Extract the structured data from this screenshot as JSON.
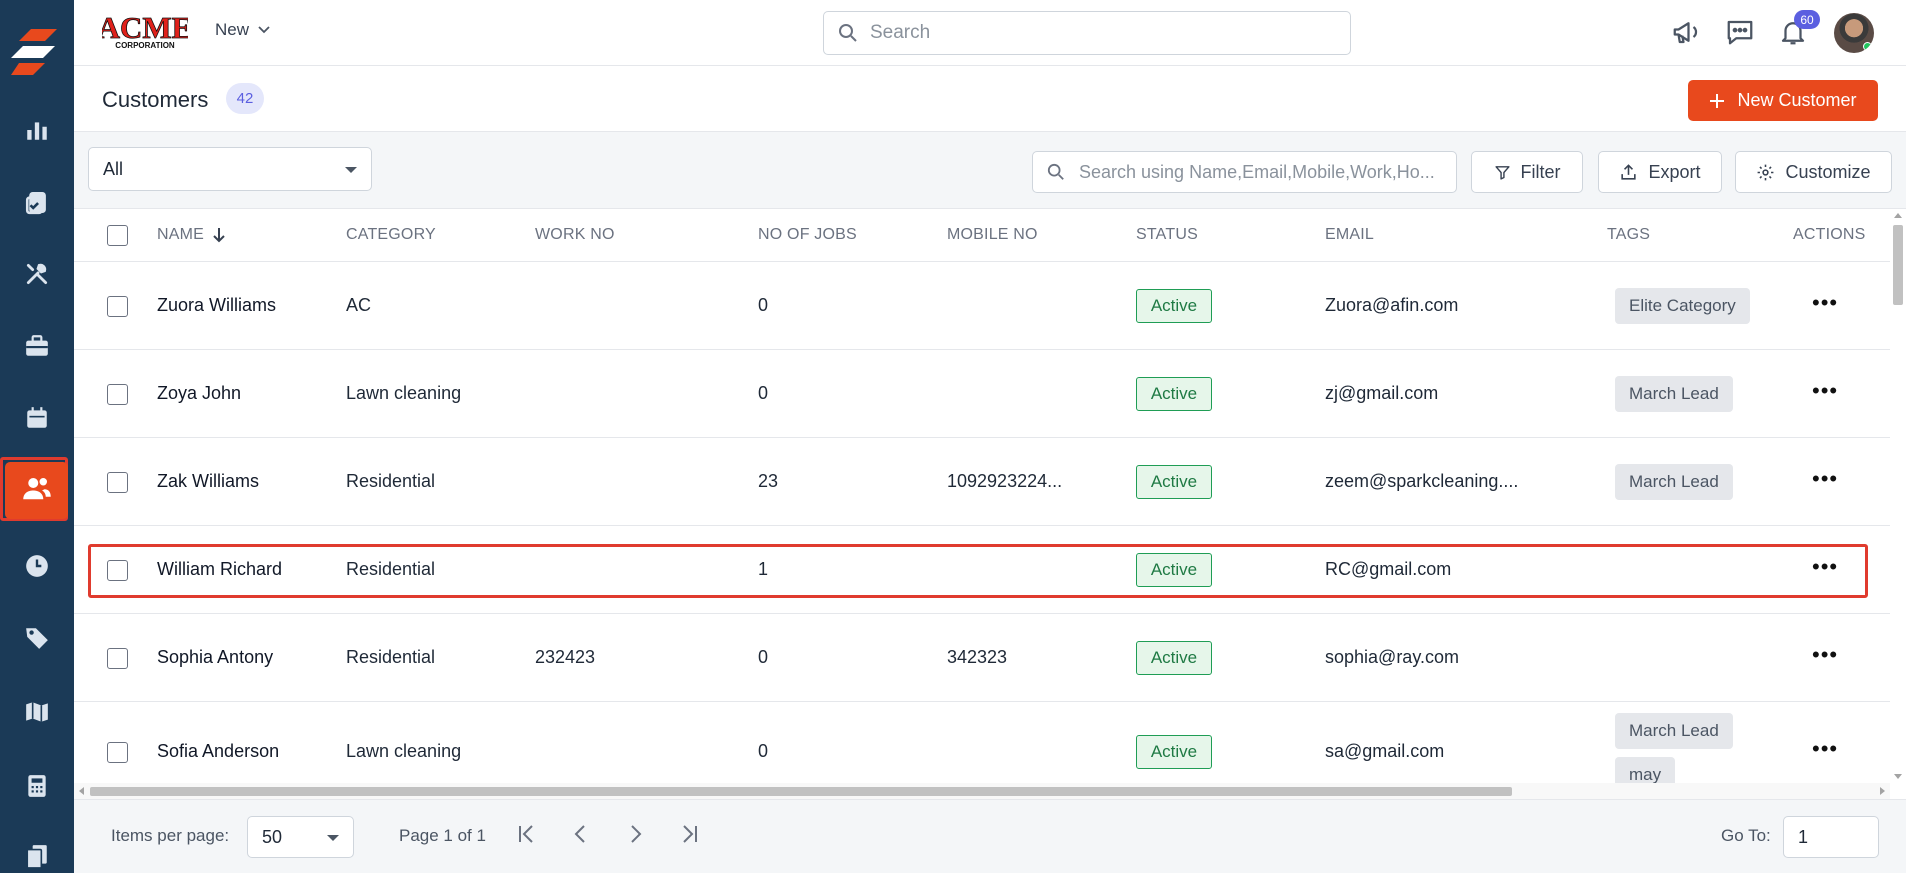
{
  "brand": {
    "logo_main": "ACME",
    "logo_sub": "CORPORATION"
  },
  "header": {
    "new_menu_label": "New",
    "search_placeholder": "Search",
    "notification_count": "60"
  },
  "sidebar": {
    "items": [
      {
        "name": "reports",
        "icon": "bar-chart-icon"
      },
      {
        "name": "jobs",
        "icon": "clipboard-check-icon"
      },
      {
        "name": "tools",
        "icon": "tools-icon"
      },
      {
        "name": "work",
        "icon": "briefcase-icon"
      },
      {
        "name": "schedule",
        "icon": "calendar-icon"
      },
      {
        "name": "customers",
        "icon": "users-icon",
        "active": true
      },
      {
        "name": "timesheet",
        "icon": "clock-icon"
      },
      {
        "name": "pricing",
        "icon": "tag-icon"
      },
      {
        "name": "map",
        "icon": "map-icon"
      },
      {
        "name": "estimates",
        "icon": "calculator-icon"
      },
      {
        "name": "documents",
        "icon": "documents-icon"
      }
    ]
  },
  "page": {
    "title": "Customers",
    "count": "42",
    "new_button": "New Customer"
  },
  "toolbar": {
    "view_value": "All",
    "search_placeholder": "Search using Name,Email,Mobile,Work,Ho...",
    "filter_label": "Filter",
    "export_label": "Export",
    "customize_label": "Customize"
  },
  "table": {
    "columns": [
      "NAME",
      "CATEGORY",
      "WORK NO",
      "NO OF JOBS",
      "MOBILE NO",
      "STATUS",
      "EMAIL",
      "TAGS",
      "ACTIONS"
    ],
    "rows": [
      {
        "name": "Zuora Williams",
        "category": "AC",
        "work_no": "",
        "jobs": "0",
        "mobile": "",
        "status": "Active",
        "email": "Zuora@afin.com",
        "tags": [
          "Elite Category"
        ]
      },
      {
        "name": "Zoya John",
        "category": "Lawn cleaning",
        "work_no": "",
        "jobs": "0",
        "mobile": "",
        "status": "Active",
        "email": "zj@gmail.com",
        "tags": [
          "March Lead"
        ]
      },
      {
        "name": "Zak Williams",
        "category": "Residential",
        "work_no": "",
        "jobs": "23",
        "mobile": "1092923224...",
        "status": "Active",
        "email": "zeem@sparkcleaning....",
        "tags": [
          "March Lead"
        ]
      },
      {
        "name": "William Richard",
        "category": "Residential",
        "work_no": "",
        "jobs": "1",
        "mobile": "",
        "status": "Active",
        "email": "RC@gmail.com",
        "tags": []
      },
      {
        "name": "Sophia Antony",
        "category": "Residential",
        "work_no": "232423",
        "jobs": "0",
        "mobile": "342323",
        "status": "Active",
        "email": "sophia@ray.com",
        "tags": []
      },
      {
        "name": "Sofia Anderson",
        "category": "Lawn cleaning",
        "work_no": "",
        "jobs": "0",
        "mobile": "",
        "status": "Active",
        "email": "sa@gmail.com",
        "tags": [
          "March Lead",
          "may"
        ]
      }
    ]
  },
  "footer": {
    "items_per_page_label": "Items per page:",
    "items_per_page_value": "50",
    "page_info": "Page 1 of 1",
    "goto_label": "Go To:",
    "goto_value": "1"
  },
  "colors": {
    "accent": "#e8491d",
    "sidebar": "#1b3a57",
    "status_green": "#1f9d55",
    "highlight": "#e03b2e",
    "count_pill": "#5b5fe0"
  }
}
